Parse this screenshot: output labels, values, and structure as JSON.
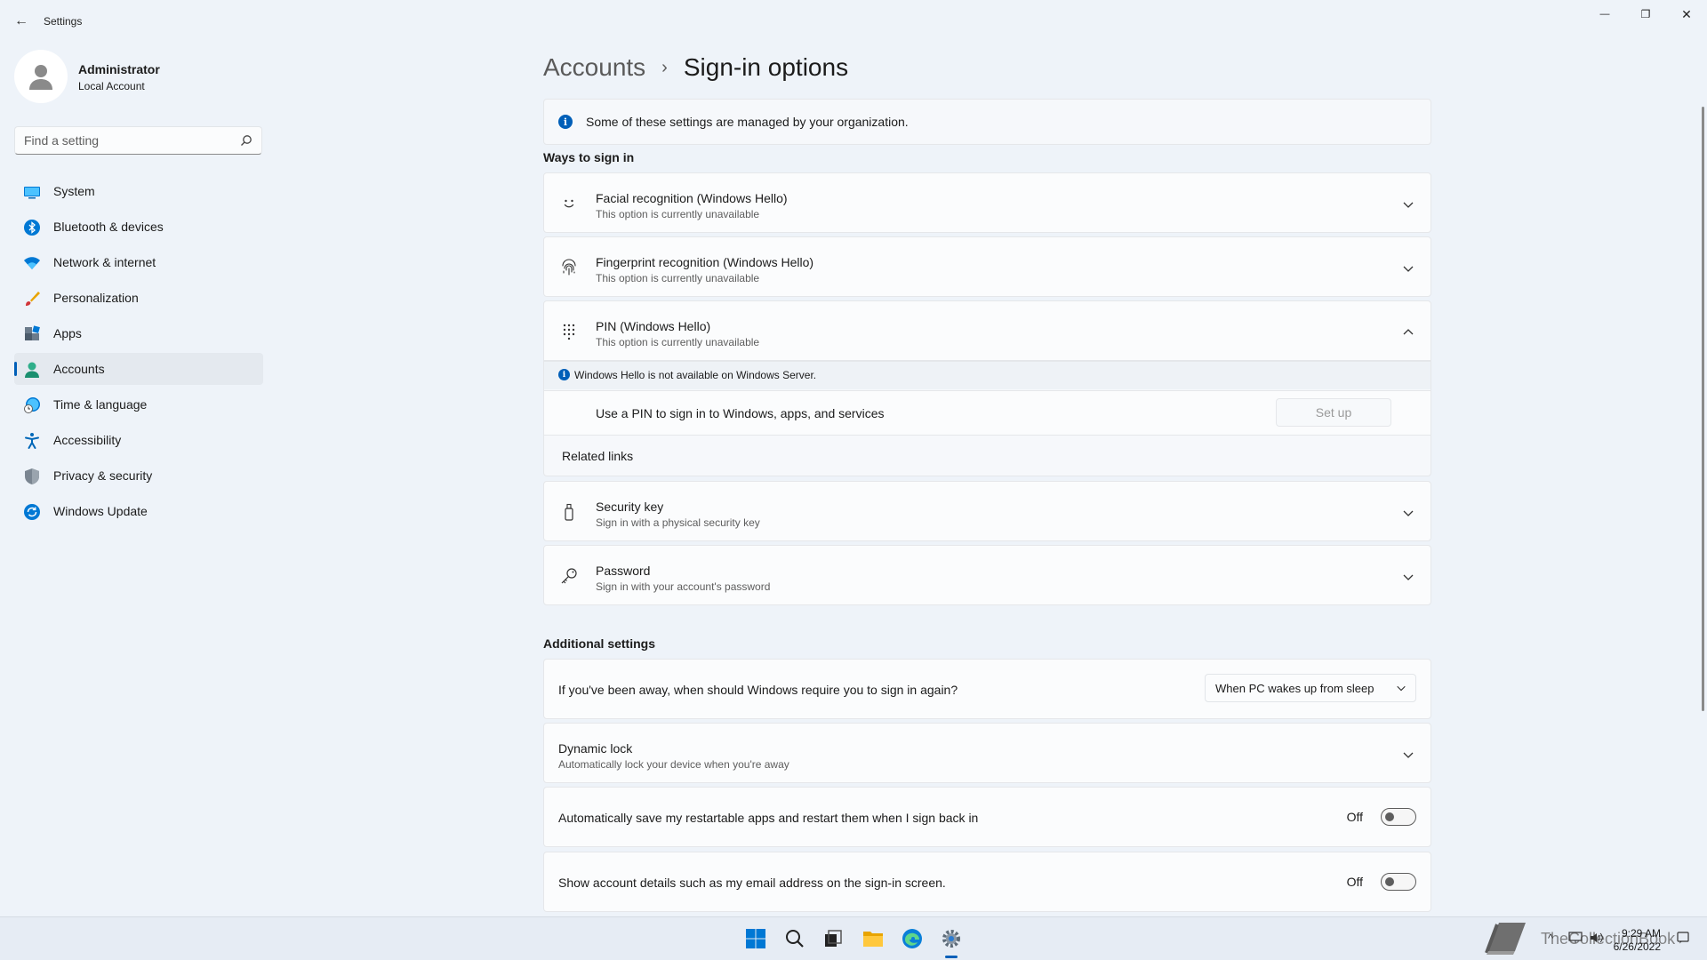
{
  "window": {
    "title": "Settings",
    "back_glyph": "←",
    "minimize_glyph": "—",
    "maximize_glyph": "❐",
    "close_glyph": "✕"
  },
  "profile": {
    "name": "Administrator",
    "account_type": "Local Account"
  },
  "search": {
    "placeholder": "Find a setting"
  },
  "sidebar": {
    "items": [
      {
        "label": "System",
        "icon": "monitor-icon"
      },
      {
        "label": "Bluetooth & devices",
        "icon": "bluetooth-icon"
      },
      {
        "label": "Network & internet",
        "icon": "wifi-icon"
      },
      {
        "label": "Personalization",
        "icon": "brush-icon"
      },
      {
        "label": "Apps",
        "icon": "apps-icon"
      },
      {
        "label": "Accounts",
        "icon": "person-icon",
        "active": true
      },
      {
        "label": "Time & language",
        "icon": "clock-globe-icon"
      },
      {
        "label": "Accessibility",
        "icon": "accessibility-icon"
      },
      {
        "label": "Privacy & security",
        "icon": "shield-icon"
      },
      {
        "label": "Windows Update",
        "icon": "update-icon"
      }
    ]
  },
  "breadcrumb": {
    "parent": "Accounts",
    "separator": "›",
    "current": "Sign-in options"
  },
  "info_banner": {
    "icon_glyph": "i",
    "text": "Some of these settings are managed by your organization."
  },
  "ways_to_sign_in": {
    "title": "Ways to sign in",
    "facial": {
      "title": "Facial recognition (Windows Hello)",
      "subtitle": "This option is currently unavailable"
    },
    "fingerprint": {
      "title": "Fingerprint recognition (Windows Hello)",
      "subtitle": "This option is currently unavailable"
    },
    "pin": {
      "title": "PIN (Windows Hello)",
      "subtitle": "This option is currently unavailable",
      "warning": "Windows Hello is not available on Windows Server.",
      "row_text": "Use a PIN to sign in to Windows, apps, and services",
      "setup_label": "Set up",
      "related_links": "Related links"
    },
    "security_key": {
      "title": "Security key",
      "subtitle": "Sign in with a physical security key"
    },
    "password": {
      "title": "Password",
      "subtitle": "Sign in with your account's password"
    }
  },
  "additional_settings": {
    "title": "Additional settings",
    "require_signin": {
      "text": "If you've been away, when should Windows require you to sign in again?",
      "selected": "When PC wakes up from sleep"
    },
    "dynamic_lock": {
      "title": "Dynamic lock",
      "subtitle": "Automatically lock your device when you're away"
    },
    "restart_apps": {
      "text": "Automatically save my restartable apps and restart them when I sign back in",
      "state_label": "Off",
      "on": false
    },
    "account_details": {
      "text": "Show account details such as my email address on the sign-in screen.",
      "state_label": "Off",
      "on": false
    }
  },
  "taskbar": {
    "time": "9:29 AM",
    "date": "6/26/2022",
    "watermark": "TheCollectionBook",
    "tray_up_glyph": "^",
    "colors": {
      "accent": "#005fb8"
    }
  }
}
